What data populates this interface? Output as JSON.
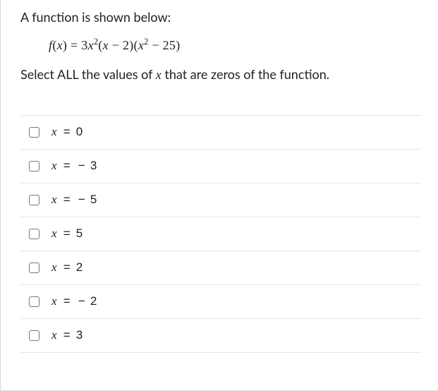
{
  "intro": "A function is shown below:",
  "formula": {
    "lhs_var": "f",
    "lhs_arg": "x",
    "rhs_plain": "= 3x²(x − 2)(x² − 25)"
  },
  "instruction_pre": "Select ALL the values of ",
  "instruction_var": "x",
  "instruction_post": " that are zeros of the function.",
  "options": [
    {
      "value": "0",
      "negative": false
    },
    {
      "value": "3",
      "negative": true
    },
    {
      "value": "5",
      "negative": true
    },
    {
      "value": "5",
      "negative": false
    },
    {
      "value": "2",
      "negative": false
    },
    {
      "value": "2",
      "negative": true
    },
    {
      "value": "3",
      "negative": false
    }
  ]
}
